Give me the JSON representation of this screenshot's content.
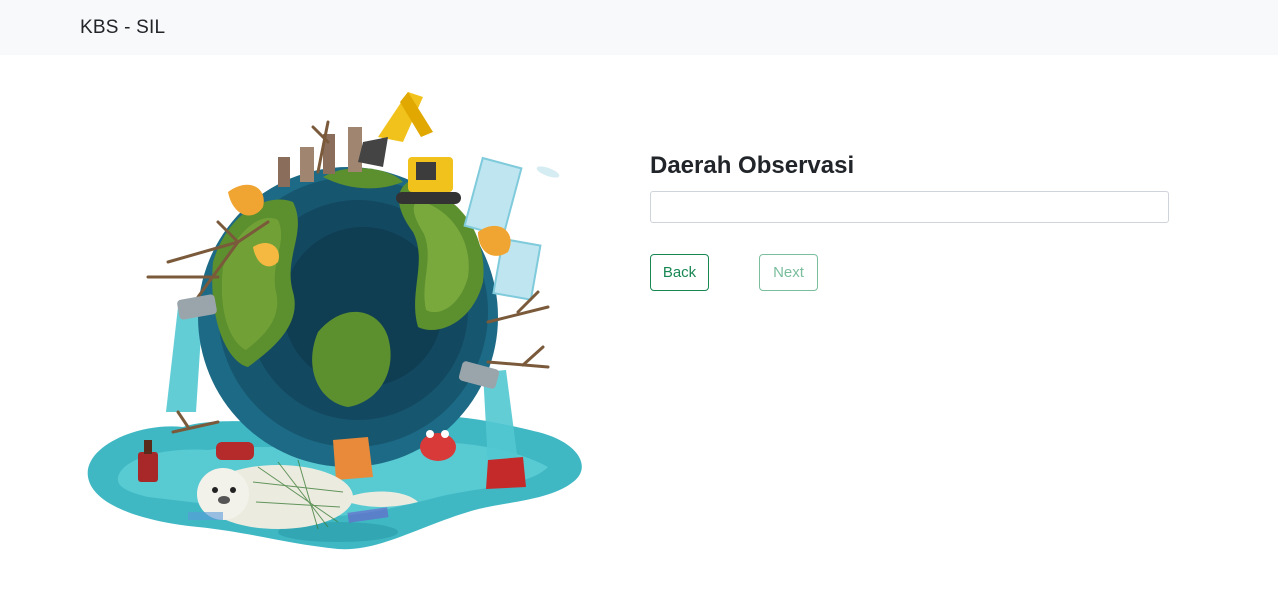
{
  "navbar": {
    "brand": "KBS - SIL"
  },
  "illustration": {
    "name": "polluted-earth-illustration"
  },
  "form": {
    "label": "Daerah Observasi",
    "input_value": "",
    "input_placeholder": "",
    "back_label": "Back",
    "next_label": "Next",
    "next_disabled": true
  },
  "colors": {
    "navbar_bg": "#f8f9fa",
    "accent_green": "#198754",
    "disabled_green": "#6cb893"
  }
}
